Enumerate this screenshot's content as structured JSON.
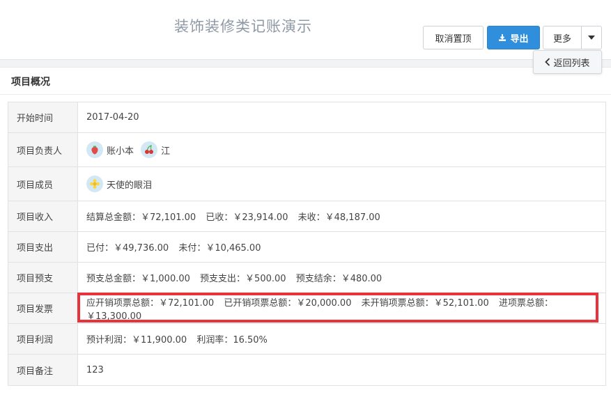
{
  "header": {
    "title": "装饰装修类记账演示",
    "unpin_label": "取消置顶",
    "export_label": "导出",
    "more_label": "更多",
    "back_label": "返回列表"
  },
  "panel": {
    "title": "项目概况"
  },
  "rows": {
    "start": {
      "label": "开始时间",
      "value": "2017-04-20"
    },
    "managers": {
      "label": "项目负责人",
      "people": [
        "账小本",
        "江"
      ]
    },
    "members": {
      "label": "项目成员",
      "people": [
        "天使的眼泪"
      ]
    },
    "income": {
      "label": "项目收入",
      "segments": [
        "结算总金额：￥72,101.00",
        "已收：￥23,914.00",
        "未收：￥48,187.00"
      ]
    },
    "expense": {
      "label": "项目支出",
      "segments": [
        "已付：￥49,736.00",
        "未付：￥10,465.00"
      ]
    },
    "advance": {
      "label": "项目预支",
      "segments": [
        "预支总金额：￥1,000.00",
        "预支支出：￥500.00",
        "预支结余：￥480.00"
      ]
    },
    "invoice": {
      "label": "项目发票",
      "segments": [
        "应开销项票总额：￥72,101.00",
        "已开销项票总额：￥20,000.00",
        "未开销项票总额：￥52,101.00",
        "进项票总额：￥13,300.00"
      ]
    },
    "profit": {
      "label": "项目利润",
      "segments": [
        "预计利润：￥11,900.00",
        "利润率：16.50%"
      ]
    },
    "note": {
      "label": "项目备注",
      "value": "123"
    }
  },
  "colors": {
    "primary": "#2f8fdc",
    "highlight": "#e8323c"
  }
}
